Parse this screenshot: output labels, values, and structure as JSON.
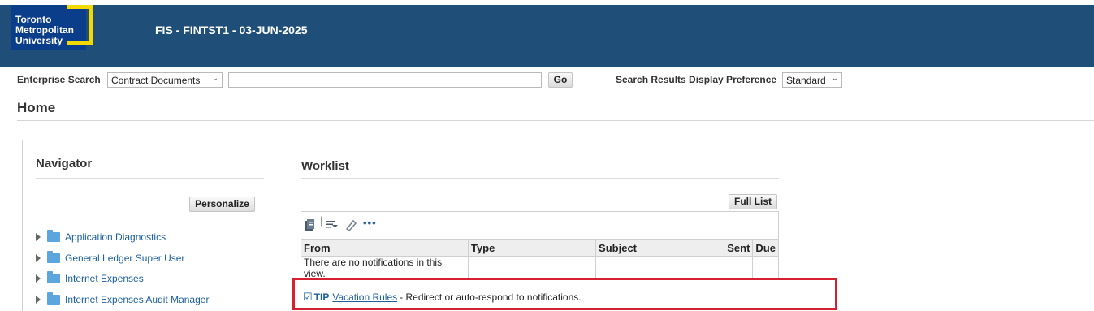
{
  "header": {
    "logo_text": "Toronto\nMetropolitan\nUniversity",
    "instance_title": "FIS - FINTST1 - 03-JUN-2025",
    "colors": {
      "banner": "#1f4e79",
      "logo_yellow": "#f5d800",
      "logo_blue": "#0a3d8a"
    }
  },
  "search": {
    "label": "Enterprise Search",
    "category_value": "Contract Documents",
    "query_value": "",
    "go_label": "Go",
    "preference_label": "Search Results Display Preference",
    "preference_value": "Standard"
  },
  "page_title": "Home",
  "navigator": {
    "title": "Navigator",
    "personalize_label": "Personalize",
    "items": [
      {
        "label": "Application Diagnostics"
      },
      {
        "label": "General Ledger Super User"
      },
      {
        "label": "Internet Expenses"
      },
      {
        "label": "Internet Expenses Audit Manager"
      }
    ]
  },
  "worklist": {
    "title": "Worklist",
    "full_list_label": "Full List",
    "toolbar_icons": [
      "notification-icon",
      "filter-icon",
      "edit-icon",
      "more-icon"
    ],
    "columns": [
      "From",
      "Type",
      "Subject",
      "Sent",
      "Due"
    ],
    "empty_message": "There are no notifications in this view."
  },
  "tip": {
    "label": "TIP",
    "link": "Vacation Rules",
    "text": "- Redirect or auto-respond to notifications.",
    "highlight_color": "#d42030"
  }
}
